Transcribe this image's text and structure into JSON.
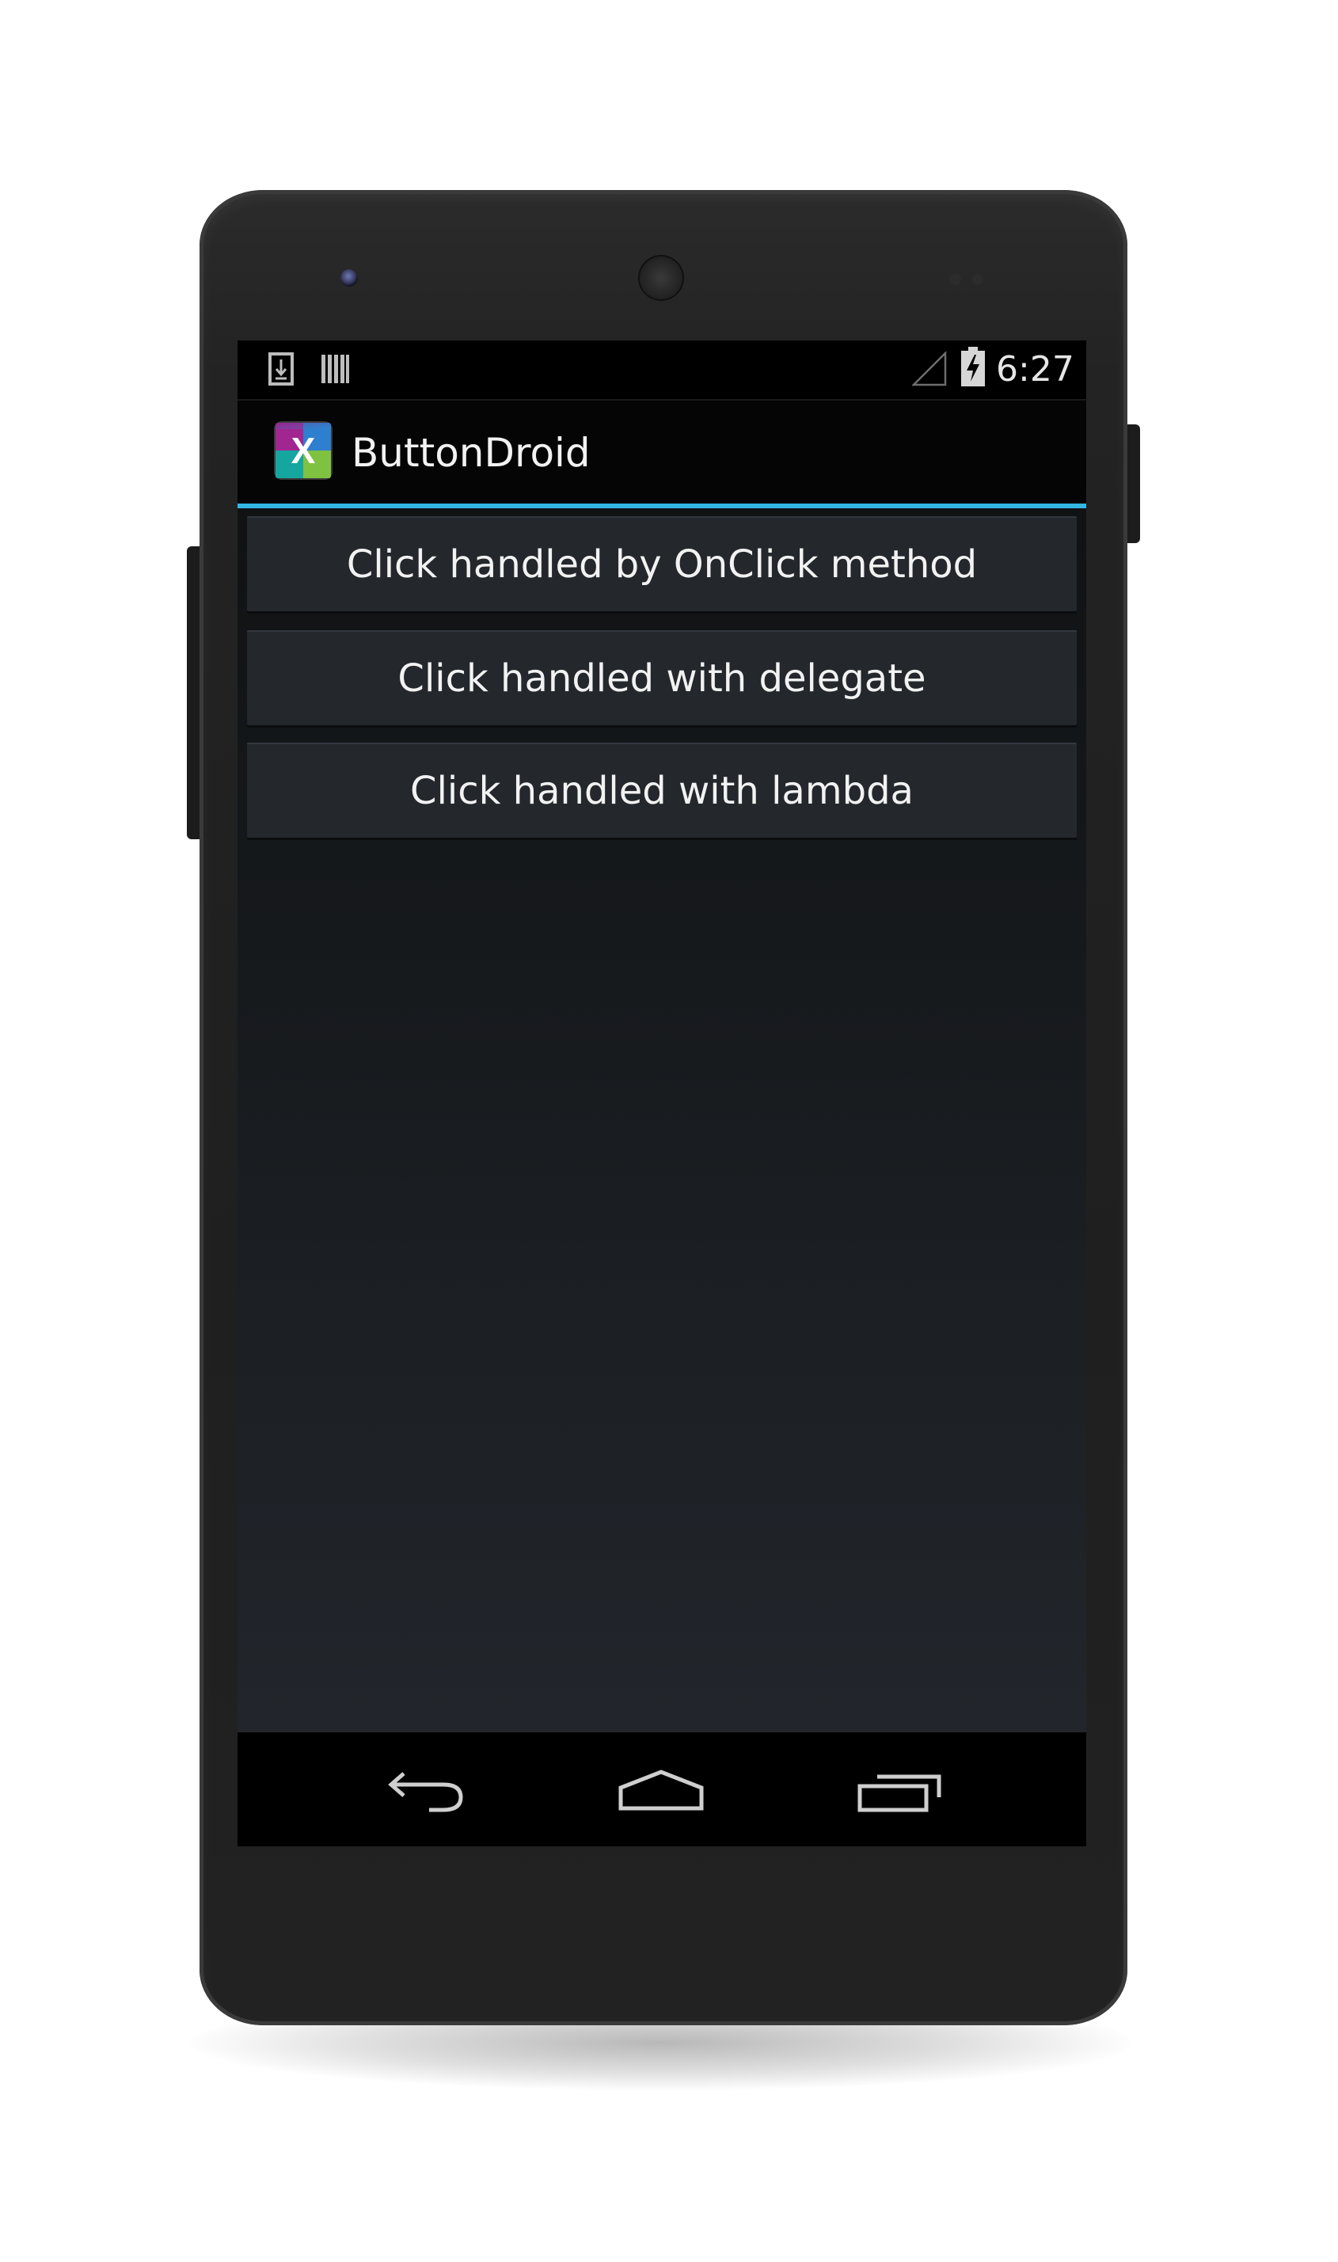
{
  "status_bar": {
    "time": "6:27",
    "icons": [
      "download-icon",
      "barcode-icon",
      "signal-icon",
      "battery-charging-icon"
    ]
  },
  "action_bar": {
    "title": "ButtonDroid",
    "app_icon": "xamarin-icon",
    "accent_color": "#33b5e5"
  },
  "buttons": [
    {
      "label": "Click handled by OnClick method"
    },
    {
      "label": "Click handled with delegate"
    },
    {
      "label": "Click handled with lambda"
    }
  ],
  "nav_bar": {
    "icons": [
      "back-icon",
      "home-icon",
      "recents-icon"
    ]
  }
}
